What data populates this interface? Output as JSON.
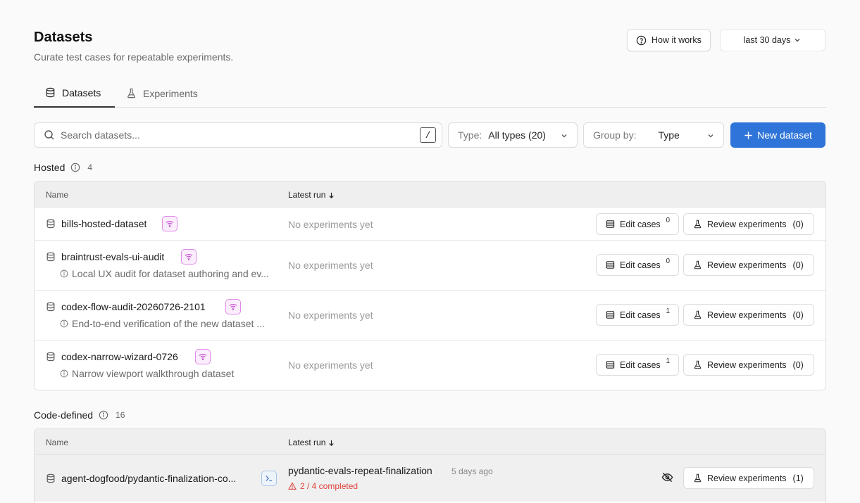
{
  "header": {
    "title": "Datasets",
    "subtitle": "Curate test cases for repeatable experiments.",
    "how_it_works": "How it works",
    "date_range": "last 30 days"
  },
  "tabs": [
    {
      "label": "Datasets",
      "active": true
    },
    {
      "label": "Experiments",
      "active": false
    }
  ],
  "toolbar": {
    "search_placeholder": "Search datasets...",
    "search_shortcut": "/",
    "type_label": "Type:",
    "type_value": "All types (20)",
    "group_label": "Group by:",
    "group_value": "Type",
    "new_dataset": "New dataset"
  },
  "hosted": {
    "title": "Hosted",
    "count": "4",
    "col_name": "Name",
    "col_latest_run": "Latest run",
    "rows": [
      {
        "name": "bills-hosted-dataset",
        "description": "",
        "latest_run": "No experiments yet",
        "edit_label": "Edit cases",
        "edit_count": "0",
        "review_label": "Review experiments",
        "review_count": "(0)"
      },
      {
        "name": "braintrust-evals-ui-audit",
        "description": "Local UX audit for dataset authoring and ev...",
        "latest_run": "No experiments yet",
        "edit_label": "Edit cases",
        "edit_count": "0",
        "review_label": "Review experiments",
        "review_count": "(0)"
      },
      {
        "name": "codex-flow-audit-20260726-2101",
        "description": "End-to-end verification of the new dataset ...",
        "latest_run": "No experiments yet",
        "edit_label": "Edit cases",
        "edit_count": "1",
        "review_label": "Review experiments",
        "review_count": "(0)"
      },
      {
        "name": "codex-narrow-wizard-0726",
        "description": "Narrow viewport walkthrough dataset",
        "latest_run": "No experiments yet",
        "edit_label": "Edit cases",
        "edit_count": "1",
        "review_label": "Review experiments",
        "review_count": "(0)"
      }
    ]
  },
  "code_defined": {
    "title": "Code-defined",
    "count": "16",
    "col_name": "Name",
    "col_latest_run": "Latest run",
    "rows": [
      {
        "name": "agent-dogfood/pydantic-finalization-co...",
        "run_name": "pydantic-evals-repeat-finalization",
        "run_ago": "5 days ago",
        "run_status": "2 / 4 completed",
        "review_label": "Review experiments",
        "review_count": "(1)"
      }
    ]
  },
  "colors": {
    "primary": "#2f74d8",
    "warning": "#e0403a",
    "hosted_badge": "#d26bdc",
    "code_badge": "#4a7fc4"
  }
}
